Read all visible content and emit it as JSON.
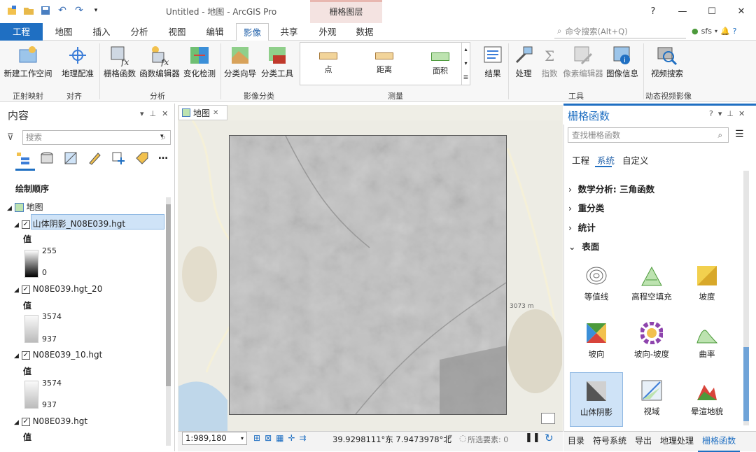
{
  "window": {
    "title": "Untitled - 地图 - ArcGIS Pro",
    "context_group": "栅格图层",
    "help": "?",
    "minimize": "—",
    "maximize": "☐",
    "close": "✕"
  },
  "tabs": [
    "工程",
    "地图",
    "插入",
    "分析",
    "视图",
    "编辑",
    "影像",
    "共享",
    "外观",
    "数据"
  ],
  "command_search": {
    "placeholder": "命令搜索(Alt+Q)"
  },
  "user": {
    "name": "sfs"
  },
  "ribbon": {
    "buttons": [
      {
        "label": "新建工作空间",
        "icon": "new-workspace-icon"
      },
      {
        "label": "地理配准",
        "icon": "georeference-icon"
      },
      {
        "label": "栅格函数",
        "icon": "raster-function-icon"
      },
      {
        "label": "函数编辑器",
        "icon": "function-editor-icon"
      },
      {
        "label": "变化检测",
        "icon": "change-detection-icon"
      },
      {
        "label": "分类向导",
        "icon": "classification-wizard-icon"
      },
      {
        "label": "分类工具",
        "icon": "classification-tools-icon"
      },
      {
        "label": "结果",
        "icon": "results-icon"
      },
      {
        "label": "处理",
        "icon": "processing-icon"
      },
      {
        "label": "指数",
        "icon": "indices-icon"
      },
      {
        "label": "像素编辑器",
        "icon": "pixel-editor-icon"
      },
      {
        "label": "图像信息",
        "icon": "image-info-icon"
      },
      {
        "label": "视频搜索",
        "icon": "video-search-icon"
      }
    ],
    "measure": [
      "点",
      "距离",
      "面积"
    ],
    "groups": [
      "正射映射",
      "对齐",
      "分析",
      "影像分类",
      "测量",
      "工具",
      "动态视频影像"
    ]
  },
  "contents": {
    "title": "内容",
    "search_placeholder": "搜索",
    "drawing_order": "绘制顺序",
    "map_name": "地图",
    "layers": [
      {
        "name": "山体阴影_N08E039.hgt",
        "legend_title": "值",
        "high": "255",
        "low": "0"
      },
      {
        "name": "N08E039.hgt_20",
        "legend_title": "值",
        "high": "3574",
        "low": "937"
      },
      {
        "name": "N08E039_10.hgt",
        "legend_title": "值",
        "high": "3574",
        "low": "937"
      },
      {
        "name": "N08E039.hgt",
        "legend_title": "值"
      }
    ]
  },
  "map": {
    "tab": "地图",
    "scale": "1:989,180",
    "coords": "39.9298111°东 7.9473978°北",
    "selected": "所选要素: 0",
    "elevation_label": "3073 m"
  },
  "raster_functions": {
    "title": "栅格函数",
    "search_placeholder": "查找栅格函数",
    "tabs": [
      "工程",
      "系统",
      "自定义"
    ],
    "categories": [
      "数学分析: 三角函数",
      "重分类",
      "统计",
      "表面"
    ],
    "functions": [
      "等值线",
      "高程空填充",
      "坡度",
      "坡向",
      "坡向-坡度",
      "曲率",
      "山体阴影",
      "视域",
      "晕渲地貌"
    ]
  },
  "bottom_tabs": [
    "目录",
    "符号系统",
    "导出",
    "地理处理",
    "栅格函数"
  ]
}
